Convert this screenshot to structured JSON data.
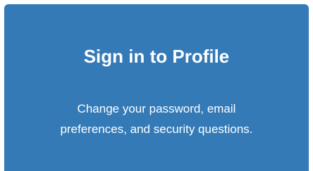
{
  "card": {
    "title": "Sign in to Profile",
    "description_line1": "Change your password, email",
    "description_line2": "preferences, and security questions.",
    "background_color": "#337ab7",
    "text_color": "#ffffff"
  }
}
